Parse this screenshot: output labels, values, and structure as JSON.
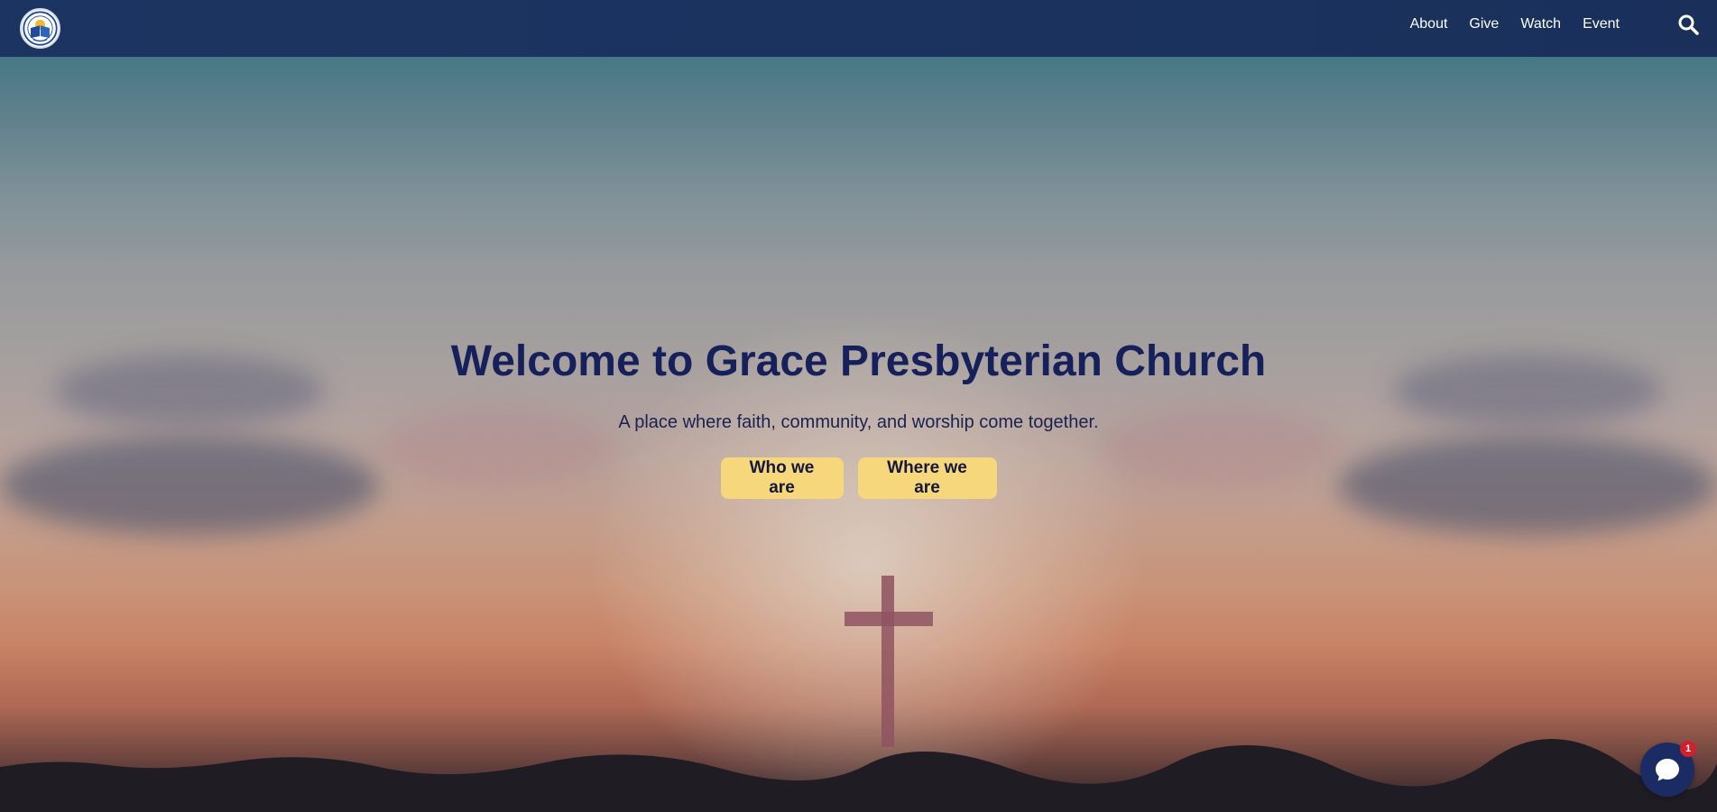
{
  "nav": {
    "logo_alt": "",
    "links": [
      {
        "label": "About"
      },
      {
        "label": "Give"
      },
      {
        "label": "Watch"
      },
      {
        "label": "Event"
      }
    ],
    "search_icon": "search-icon",
    "background_color": "#1b335f"
  },
  "hero": {
    "title": "Welcome to Grace Presbyterian Church",
    "subtitle": "A place where faith, community, and worship come together.",
    "buttons": [
      {
        "label": "Who we are"
      },
      {
        "label": "Where we are"
      }
    ],
    "button_color": "#f6d77c",
    "title_color": "#16205a"
  },
  "chat": {
    "icon": "chat-bubble-icon",
    "badge_count": "1",
    "badge_color": "#d0202e"
  }
}
